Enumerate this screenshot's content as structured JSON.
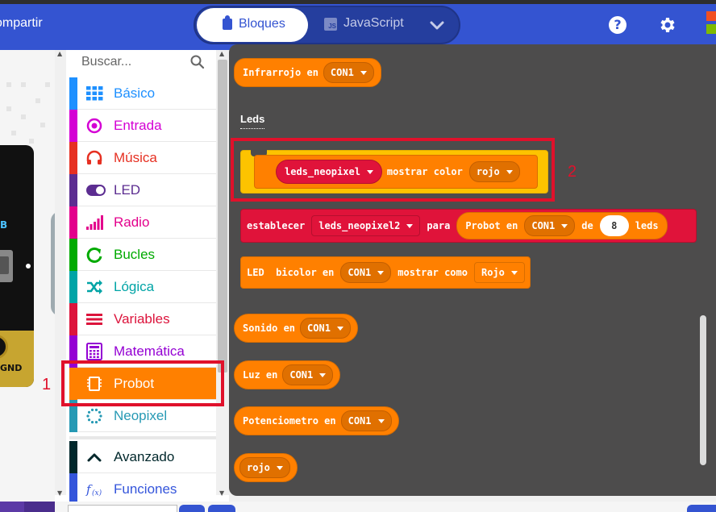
{
  "header": {
    "share_label": "ompartir",
    "tabs": {
      "blocks": "Bloques",
      "javascript": "JavaScript"
    },
    "js_icon_text": "JS",
    "help_glyph": "?",
    "brand_colors": [
      "#f25022",
      "#7fba00",
      "#00a4ef"
    ]
  },
  "simulator": {
    "button_label": "B",
    "pin_label": "GND"
  },
  "toolbox": {
    "search_placeholder": "Buscar...",
    "categories": [
      {
        "label": "Básico",
        "color": "#1e90ff",
        "icon": "grid-icon"
      },
      {
        "label": "Entrada",
        "color": "#d400d4",
        "icon": "target-icon"
      },
      {
        "label": "Música",
        "color": "#e63022",
        "icon": "headphones-icon"
      },
      {
        "label": "LED",
        "color": "#5c2d91",
        "icon": "toggle-icon"
      },
      {
        "label": "Radio",
        "color": "#e3008c",
        "icon": "signal-bars-icon"
      },
      {
        "label": "Bucles",
        "color": "#00aa00",
        "icon": "loop-icon"
      },
      {
        "label": "Lógica",
        "color": "#00a4a6",
        "icon": "shuffle-icon"
      },
      {
        "label": "Variables",
        "color": "#dc143c",
        "icon": "lines-icon"
      },
      {
        "label": "Matemática",
        "color": "#9400d3",
        "icon": "calculator-icon"
      },
      {
        "label": "Probot",
        "color": "#ff8000",
        "icon": "chip-icon"
      },
      {
        "label": "Neopixel",
        "color": "#2699b4",
        "icon": "dots-ring-icon"
      },
      {
        "label": "Avanzado",
        "color": "#00272b",
        "icon": "chevron-up-icon"
      },
      {
        "label": "Funciones",
        "color": "#3455db",
        "icon": "function-icon"
      }
    ],
    "selected": "Probot"
  },
  "workspace": {
    "block1": {
      "text": "Infrarrojo en",
      "dropdown": "CON1"
    },
    "section_label": "Leds",
    "stmt": {
      "var": "leds_neopixel",
      "text": "mostrar color",
      "dropdown": "rojo"
    },
    "set_block": {
      "text1": "establecer",
      "var": "leds_neopixel2",
      "text2": "para",
      "inner_text": "Probot en",
      "inner_dd": "CON1",
      "text3": "de",
      "number": "8",
      "text4": "leds"
    },
    "bicolor": {
      "text1": "LED  bicolor en",
      "dropdown": "CON1",
      "text2": "mostrar como",
      "dropdown2": "Rojo"
    },
    "sonido": {
      "text": "Sonido en",
      "dropdown": "CON1"
    },
    "luz": {
      "text": "Luz en",
      "dropdown": "CON1"
    },
    "potenciometro": {
      "text": "Potenciometro en",
      "dropdown": "CON1"
    },
    "rojo": {
      "dropdown": "rojo"
    }
  },
  "annotations": {
    "one": "1",
    "two": "2",
    "color": "#e0112b"
  }
}
